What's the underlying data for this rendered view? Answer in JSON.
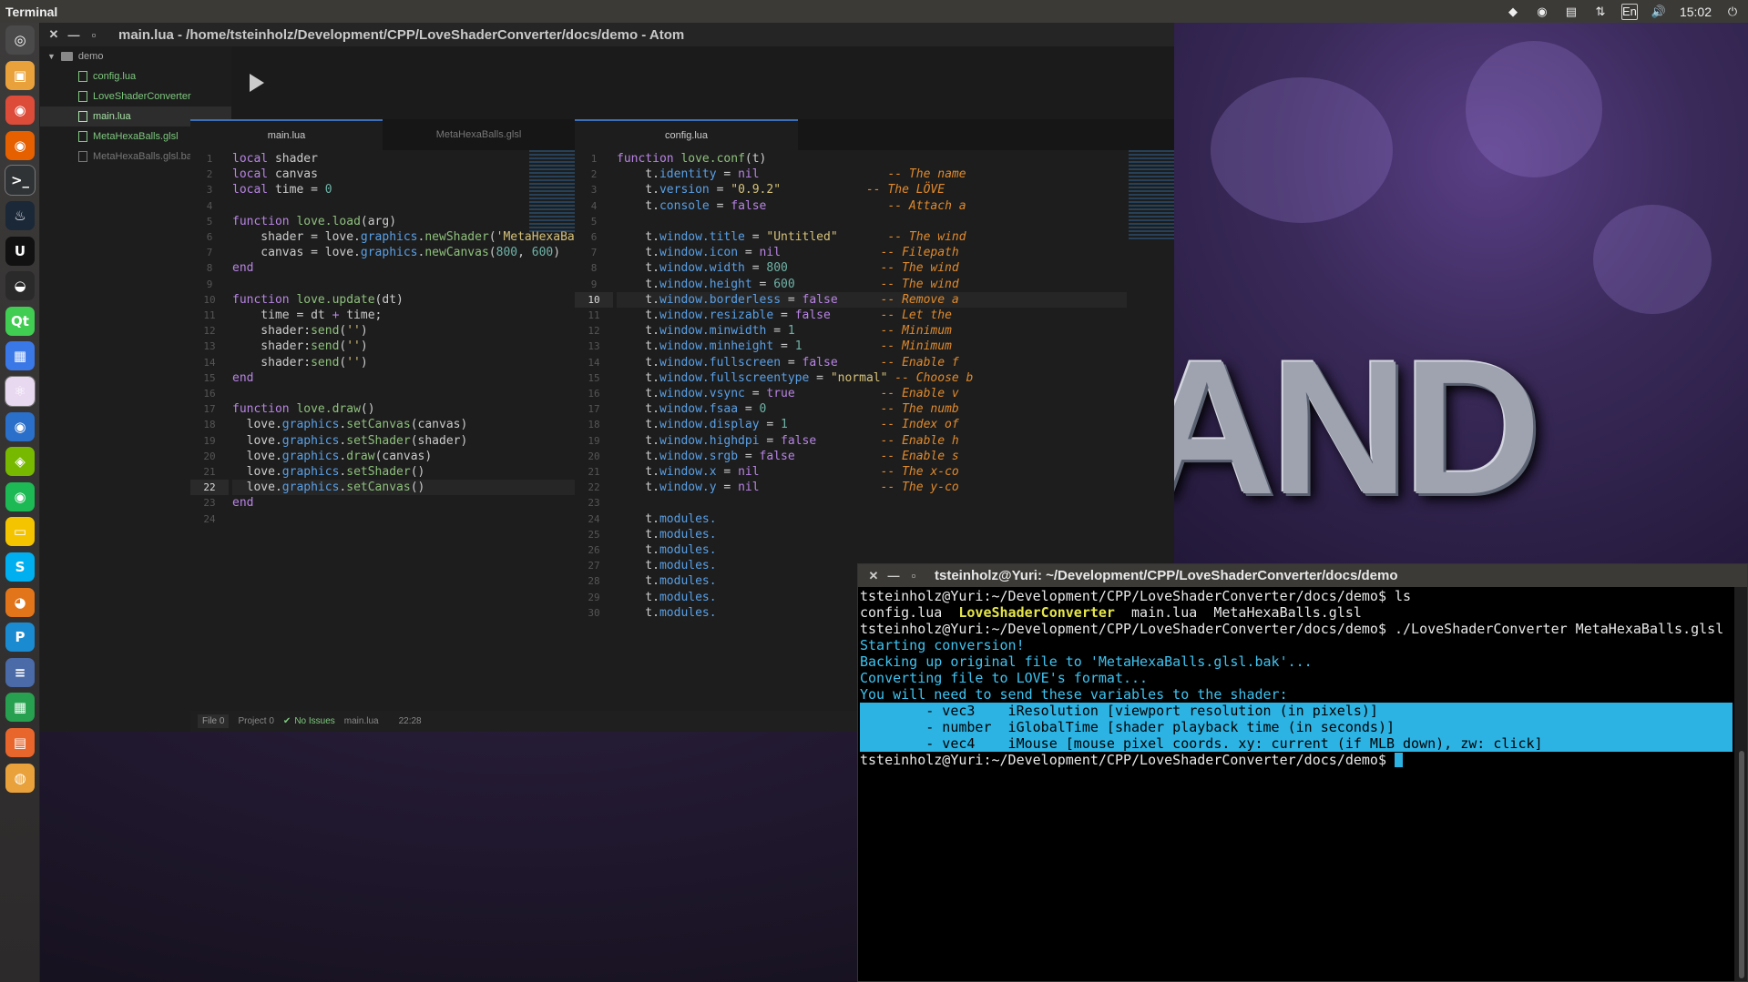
{
  "topbar": {
    "title": "Terminal",
    "clock": "15:02",
    "lang": "En"
  },
  "launcher": {
    "items": [
      "ubuntu-dash",
      "files",
      "chrome",
      "firefox",
      "terminal",
      "steam",
      "unreal-engine",
      "blender",
      "qt-creator",
      "software-center",
      "atom",
      "chromium",
      "nvidia",
      "spotify",
      "remote-desktop",
      "skype",
      "gimp",
      "pycharm",
      "text-editor",
      "spreadsheet",
      "impress",
      "software-updater"
    ]
  },
  "atom": {
    "title": "main.lua - /home/tsteinholz/Development/CPP/LoveShaderConverter/docs/demo - Atom",
    "tree": {
      "root": "demo",
      "files": [
        {
          "name": "config.lua",
          "state": "normal"
        },
        {
          "name": "LoveShaderConverter",
          "state": "normal"
        },
        {
          "name": "main.lua",
          "state": "active"
        },
        {
          "name": "MetaHexaBalls.glsl",
          "state": "normal"
        },
        {
          "name": "MetaHexaBalls.glsl.bak",
          "state": "dim"
        }
      ]
    },
    "left_tabs": [
      "main.lua",
      "MetaHexaBalls.glsl"
    ],
    "right_tabs": [
      "config.lua"
    ],
    "status": {
      "file": "File 0",
      "project": "Project 0",
      "issues": "No Issues",
      "filename": "main.lua",
      "cursor": "22:28"
    }
  },
  "left_code": [
    [
      [
        "kw",
        "local "
      ],
      [
        "pl",
        "shader"
      ]
    ],
    [
      [
        "kw",
        "local "
      ],
      [
        "pl",
        "canvas"
      ]
    ],
    [
      [
        "kw",
        "local "
      ],
      [
        "pl",
        "time "
      ],
      [
        "pl",
        "= "
      ],
      [
        "num",
        "0"
      ]
    ],
    [],
    [
      [
        "kw",
        "function "
      ],
      [
        "fn",
        "love.load"
      ],
      [
        "pl",
        "(arg)"
      ]
    ],
    [
      [
        "pl",
        "    shader = love."
      ],
      [
        "gr",
        "graphics"
      ],
      [
        "pl",
        "."
      ],
      [
        "fn",
        "newShader"
      ],
      [
        "pl",
        "("
      ],
      [
        "str",
        "'MetaHexaBalls"
      ]
    ],
    [
      [
        "pl",
        "    canvas = love."
      ],
      [
        "gr",
        "graphics"
      ],
      [
        "pl",
        "."
      ],
      [
        "fn",
        "newCanvas"
      ],
      [
        "pl",
        "("
      ],
      [
        "num",
        "800"
      ],
      [
        "pl",
        ", "
      ],
      [
        "num",
        "600"
      ],
      [
        "pl",
        ")"
      ]
    ],
    [
      [
        "kw",
        "end"
      ]
    ],
    [],
    [
      [
        "kw",
        "function "
      ],
      [
        "fn",
        "love.update"
      ],
      [
        "pl",
        "(dt)"
      ]
    ],
    [
      [
        "pl",
        "    time = dt "
      ],
      [
        "kw",
        "+"
      ],
      [
        "pl",
        " time;"
      ]
    ],
    [
      [
        "pl",
        "    shader:"
      ],
      [
        "fn",
        "send"
      ],
      [
        "pl",
        "("
      ],
      [
        "str",
        "''"
      ],
      [
        "pl",
        ")"
      ]
    ],
    [
      [
        "pl",
        "    shader:"
      ],
      [
        "fn",
        "send"
      ],
      [
        "pl",
        "("
      ],
      [
        "str",
        "''"
      ],
      [
        "pl",
        ")"
      ]
    ],
    [
      [
        "pl",
        "    shader:"
      ],
      [
        "fn",
        "send"
      ],
      [
        "pl",
        "("
      ],
      [
        "str",
        "''"
      ],
      [
        "pl",
        ")"
      ]
    ],
    [
      [
        "kw",
        "end"
      ]
    ],
    [],
    [
      [
        "kw",
        "function "
      ],
      [
        "fn",
        "love.draw"
      ],
      [
        "pl",
        "()"
      ]
    ],
    [
      [
        "pl",
        "  love."
      ],
      [
        "gr",
        "graphics"
      ],
      [
        "pl",
        "."
      ],
      [
        "fn",
        "setCanvas"
      ],
      [
        "pl",
        "(canvas)"
      ]
    ],
    [
      [
        "pl",
        "  love."
      ],
      [
        "gr",
        "graphics"
      ],
      [
        "pl",
        "."
      ],
      [
        "fn",
        "setShader"
      ],
      [
        "pl",
        "(shader)"
      ]
    ],
    [
      [
        "pl",
        "  love."
      ],
      [
        "gr",
        "graphics"
      ],
      [
        "pl",
        "."
      ],
      [
        "fn",
        "draw"
      ],
      [
        "pl",
        "(canvas)"
      ]
    ],
    [
      [
        "pl",
        "  love."
      ],
      [
        "gr",
        "graphics"
      ],
      [
        "pl",
        "."
      ],
      [
        "fn",
        "setShader"
      ],
      [
        "pl",
        "()"
      ]
    ],
    [
      [
        "pl",
        "  love."
      ],
      [
        "gr",
        "graphics"
      ],
      [
        "pl",
        "."
      ],
      [
        "fn",
        "setCanvas"
      ],
      [
        "pl",
        "()"
      ]
    ],
    [
      [
        "kw",
        "end"
      ]
    ],
    []
  ],
  "left_current_line": 22,
  "right_code": [
    [
      [
        "kw",
        "function "
      ],
      [
        "fn",
        "love.conf"
      ],
      [
        "pl",
        "(t)"
      ]
    ],
    [
      [
        "pl",
        "    t."
      ],
      [
        "gr",
        "identity"
      ],
      [
        "pl",
        " = "
      ],
      [
        "kw",
        "nil"
      ],
      [
        "pl",
        "                  "
      ],
      [
        "cm",
        "-- The name"
      ]
    ],
    [
      [
        "pl",
        "    t."
      ],
      [
        "gr",
        "version"
      ],
      [
        "pl",
        " = "
      ],
      [
        "str",
        "\"0.9.2\""
      ],
      [
        "pl",
        "            "
      ],
      [
        "cm",
        "-- The LÖVE"
      ]
    ],
    [
      [
        "pl",
        "    t."
      ],
      [
        "gr",
        "console"
      ],
      [
        "pl",
        " = "
      ],
      [
        "kw",
        "false"
      ],
      [
        "pl",
        "                 "
      ],
      [
        "cm",
        "-- Attach a"
      ]
    ],
    [],
    [
      [
        "pl",
        "    t."
      ],
      [
        "gr",
        "window.title"
      ],
      [
        "pl",
        " = "
      ],
      [
        "str",
        "\"Untitled\""
      ],
      [
        "pl",
        "       "
      ],
      [
        "cm",
        "-- The wind"
      ]
    ],
    [
      [
        "pl",
        "    t."
      ],
      [
        "gr",
        "window.icon"
      ],
      [
        "pl",
        " = "
      ],
      [
        "kw",
        "nil"
      ],
      [
        "pl",
        "              "
      ],
      [
        "cm",
        "-- Filepath"
      ]
    ],
    [
      [
        "pl",
        "    t."
      ],
      [
        "gr",
        "window.width"
      ],
      [
        "pl",
        " = "
      ],
      [
        "num",
        "800"
      ],
      [
        "pl",
        "             "
      ],
      [
        "cm",
        "-- The wind"
      ]
    ],
    [
      [
        "pl",
        "    t."
      ],
      [
        "gr",
        "window.height"
      ],
      [
        "pl",
        " = "
      ],
      [
        "num",
        "600"
      ],
      [
        "pl",
        "            "
      ],
      [
        "cm",
        "-- The wind"
      ]
    ],
    [
      [
        "pl",
        "    t."
      ],
      [
        "gr",
        "window.borderless"
      ],
      [
        "pl",
        " = "
      ],
      [
        "kw",
        "false"
      ],
      [
        "pl",
        "      "
      ],
      [
        "cm",
        "-- Remove a"
      ]
    ],
    [
      [
        "pl",
        "    t."
      ],
      [
        "gr",
        "window.resizable"
      ],
      [
        "pl",
        " = "
      ],
      [
        "kw",
        "false"
      ],
      [
        "pl",
        "       "
      ],
      [
        "cm",
        "-- Let the"
      ]
    ],
    [
      [
        "pl",
        "    t."
      ],
      [
        "gr",
        "window.minwidth"
      ],
      [
        "pl",
        " = "
      ],
      [
        "num",
        "1"
      ],
      [
        "pl",
        "            "
      ],
      [
        "cm",
        "-- Minimum"
      ]
    ],
    [
      [
        "pl",
        "    t."
      ],
      [
        "gr",
        "window.minheight"
      ],
      [
        "pl",
        " = "
      ],
      [
        "num",
        "1"
      ],
      [
        "pl",
        "           "
      ],
      [
        "cm",
        "-- Minimum"
      ]
    ],
    [
      [
        "pl",
        "    t."
      ],
      [
        "gr",
        "window.fullscreen"
      ],
      [
        "pl",
        " = "
      ],
      [
        "kw",
        "false"
      ],
      [
        "pl",
        "      "
      ],
      [
        "cm",
        "-- Enable f"
      ]
    ],
    [
      [
        "pl",
        "    t."
      ],
      [
        "gr",
        "window.fullscreentype"
      ],
      [
        "pl",
        " = "
      ],
      [
        "str",
        "\"normal\""
      ],
      [
        "pl",
        " "
      ],
      [
        "cm",
        "-- Choose b"
      ]
    ],
    [
      [
        "pl",
        "    t."
      ],
      [
        "gr",
        "window.vsync"
      ],
      [
        "pl",
        " = "
      ],
      [
        "kw",
        "true"
      ],
      [
        "pl",
        "            "
      ],
      [
        "cm",
        "-- Enable v"
      ]
    ],
    [
      [
        "pl",
        "    t."
      ],
      [
        "gr",
        "window.fsaa"
      ],
      [
        "pl",
        " = "
      ],
      [
        "num",
        "0"
      ],
      [
        "pl",
        "                "
      ],
      [
        "cm",
        "-- The numb"
      ]
    ],
    [
      [
        "pl",
        "    t."
      ],
      [
        "gr",
        "window.display"
      ],
      [
        "pl",
        " = "
      ],
      [
        "num",
        "1"
      ],
      [
        "pl",
        "             "
      ],
      [
        "cm",
        "-- Index of"
      ]
    ],
    [
      [
        "pl",
        "    t."
      ],
      [
        "gr",
        "window.highdpi"
      ],
      [
        "pl",
        " = "
      ],
      [
        "kw",
        "false"
      ],
      [
        "pl",
        "         "
      ],
      [
        "cm",
        "-- Enable h"
      ]
    ],
    [
      [
        "pl",
        "    t."
      ],
      [
        "gr",
        "window.srgb"
      ],
      [
        "pl",
        " = "
      ],
      [
        "kw",
        "false"
      ],
      [
        "pl",
        "            "
      ],
      [
        "cm",
        "-- Enable s"
      ]
    ],
    [
      [
        "pl",
        "    t."
      ],
      [
        "gr",
        "window.x"
      ],
      [
        "pl",
        " = "
      ],
      [
        "kw",
        "nil"
      ],
      [
        "pl",
        "                 "
      ],
      [
        "cm",
        "-- The x-co"
      ]
    ],
    [
      [
        "pl",
        "    t."
      ],
      [
        "gr",
        "window.y"
      ],
      [
        "pl",
        " = "
      ],
      [
        "kw",
        "nil"
      ],
      [
        "pl",
        "                 "
      ],
      [
        "cm",
        "-- The y-co"
      ]
    ],
    [],
    [
      [
        "pl",
        "    t."
      ],
      [
        "gr",
        "modules."
      ]
    ],
    [
      [
        "pl",
        "    t."
      ],
      [
        "gr",
        "modules."
      ]
    ],
    [
      [
        "pl",
        "    t."
      ],
      [
        "gr",
        "modules."
      ]
    ],
    [
      [
        "pl",
        "    t."
      ],
      [
        "gr",
        "modules."
      ]
    ],
    [
      [
        "pl",
        "    t."
      ],
      [
        "gr",
        "modules."
      ]
    ],
    [
      [
        "pl",
        "    t."
      ],
      [
        "gr",
        "modules."
      ]
    ],
    [
      [
        "pl",
        "    t."
      ],
      [
        "gr",
        "modules."
      ]
    ]
  ],
  "right_current_line": 10,
  "terminal": {
    "title": "tsteinholz@Yuri: ~/Development/CPP/LoveShaderConverter/docs/demo",
    "lines": [
      {
        "style": "normal",
        "segments": [
          [
            "",
            "tsteinholz@Yuri:~/Development/CPP/LoveShaderConverter/docs/demo$ ls"
          ]
        ]
      },
      {
        "style": "normal",
        "segments": [
          [
            "",
            "config.lua  "
          ],
          [
            "gnb",
            "LoveShaderConverter"
          ],
          [
            "",
            "  main.lua  MetaHexaBalls.glsl"
          ]
        ]
      },
      {
        "style": "normal",
        "segments": [
          [
            "",
            "tsteinholz@Yuri:~/Development/CPP/LoveShaderConverter/docs/demo$ ./LoveShaderConverter MetaHexaBalls.glsl"
          ]
        ]
      },
      {
        "style": "cyan",
        "segments": [
          [
            "",
            "Starting conversion!"
          ]
        ]
      },
      {
        "style": "cyan",
        "segments": [
          [
            "",
            "Backing up original file to 'MetaHexaBalls.glsl.bak'..."
          ]
        ]
      },
      {
        "style": "cyan",
        "segments": [
          [
            "",
            "Converting file to LOVE's format..."
          ]
        ]
      },
      {
        "style": "cyan",
        "segments": [
          [
            "",
            "You will need to send these variables to the shader:"
          ]
        ]
      },
      {
        "style": "highlight",
        "segments": [
          [
            "",
            "        - vec3    iResolution [viewport resolution (in pixels)]"
          ]
        ]
      },
      {
        "style": "highlight",
        "segments": [
          [
            "",
            "        - number  iGlobalTime [shader playback time (in seconds)]"
          ]
        ]
      },
      {
        "style": "highlight",
        "segments": [
          [
            "",
            "        - vec4    iMouse [mouse pixel coords. xy: current (if MLB down), zw: click]"
          ]
        ]
      },
      {
        "style": "normal",
        "segments": [
          [
            "",
            "tsteinholz@Yuri:~/Development/CPP/LoveShaderConverter/docs/demo$ "
          ]
        ],
        "cursor": true
      }
    ]
  },
  "wallpaper": {
    "text": "AND"
  },
  "colors": {
    "accent": "#2cb3e3",
    "tree_green": "#7ec87e",
    "keyword": "#b884e4",
    "comment": "#e08a2c"
  }
}
